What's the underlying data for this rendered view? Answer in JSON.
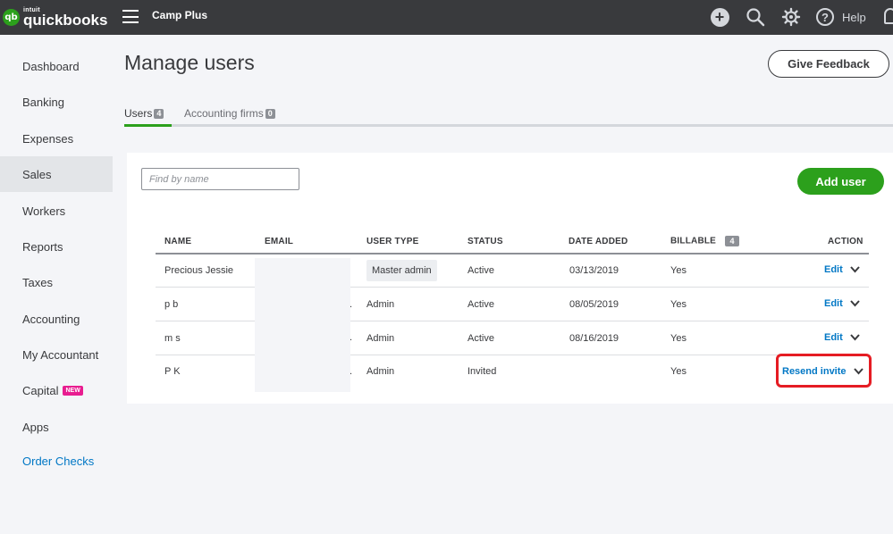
{
  "header": {
    "logo_intuit": "intuit",
    "logo_name": "quickbooks",
    "logo_badge": "qb",
    "company": "Camp Plus",
    "help_label": "Help",
    "icons": [
      "menu-icon",
      "plus-icon",
      "search-icon",
      "gear-icon",
      "help-icon",
      "bell-icon"
    ]
  },
  "sidebar": {
    "items": [
      {
        "label": "Dashboard"
      },
      {
        "label": "Banking"
      },
      {
        "label": "Expenses"
      },
      {
        "label": "Sales",
        "active": true
      },
      {
        "label": "Workers"
      },
      {
        "label": "Reports"
      },
      {
        "label": "Taxes"
      },
      {
        "label": "Accounting"
      },
      {
        "label": "My Accountant"
      },
      {
        "label": "Capital",
        "badge": "NEW"
      },
      {
        "label": "Apps"
      },
      {
        "label": "Order Checks",
        "link": true
      }
    ]
  },
  "page": {
    "title": "Manage users",
    "feedback_button": "Give Feedback",
    "tabs": [
      {
        "label": "Users",
        "count": "4",
        "active": true
      },
      {
        "label": "Accounting firms",
        "count": "0"
      }
    ],
    "search_placeholder": "Find by name",
    "add_button": "Add user"
  },
  "table": {
    "headers": {
      "name": "NAME",
      "email": "EMAIL",
      "user_type": "USER TYPE",
      "status": "STATUS",
      "date_added": "DATE ADDED",
      "billable": "BILLABLE",
      "billable_count": "4",
      "action": "ACTION"
    },
    "rows": [
      {
        "name": "Precious Jessie",
        "user_type": "Master admin",
        "status": "Active",
        "date_added": "03/13/2019",
        "billable": "Yes",
        "action": "Edit"
      },
      {
        "name": "p b",
        "user_type": "Admin",
        "status": "Active",
        "date_added": "08/05/2019",
        "billable": "Yes",
        "action": "Edit"
      },
      {
        "name": "m s",
        "user_type": "Admin",
        "status": "Active",
        "date_added": "08/16/2019",
        "billable": "Yes",
        "action": "Edit"
      },
      {
        "name": "P K",
        "user_type": "Admin",
        "status": "Invited",
        "date_added": "",
        "billable": "Yes",
        "action": "Resend invite"
      }
    ],
    "email_truncation": "."
  },
  "colors": {
    "topbar": "#393a3d",
    "brand_green": "#2ca01c",
    "link_blue": "#0077c5",
    "new_badge": "#e81d90",
    "highlight_red": "#e51c23"
  }
}
